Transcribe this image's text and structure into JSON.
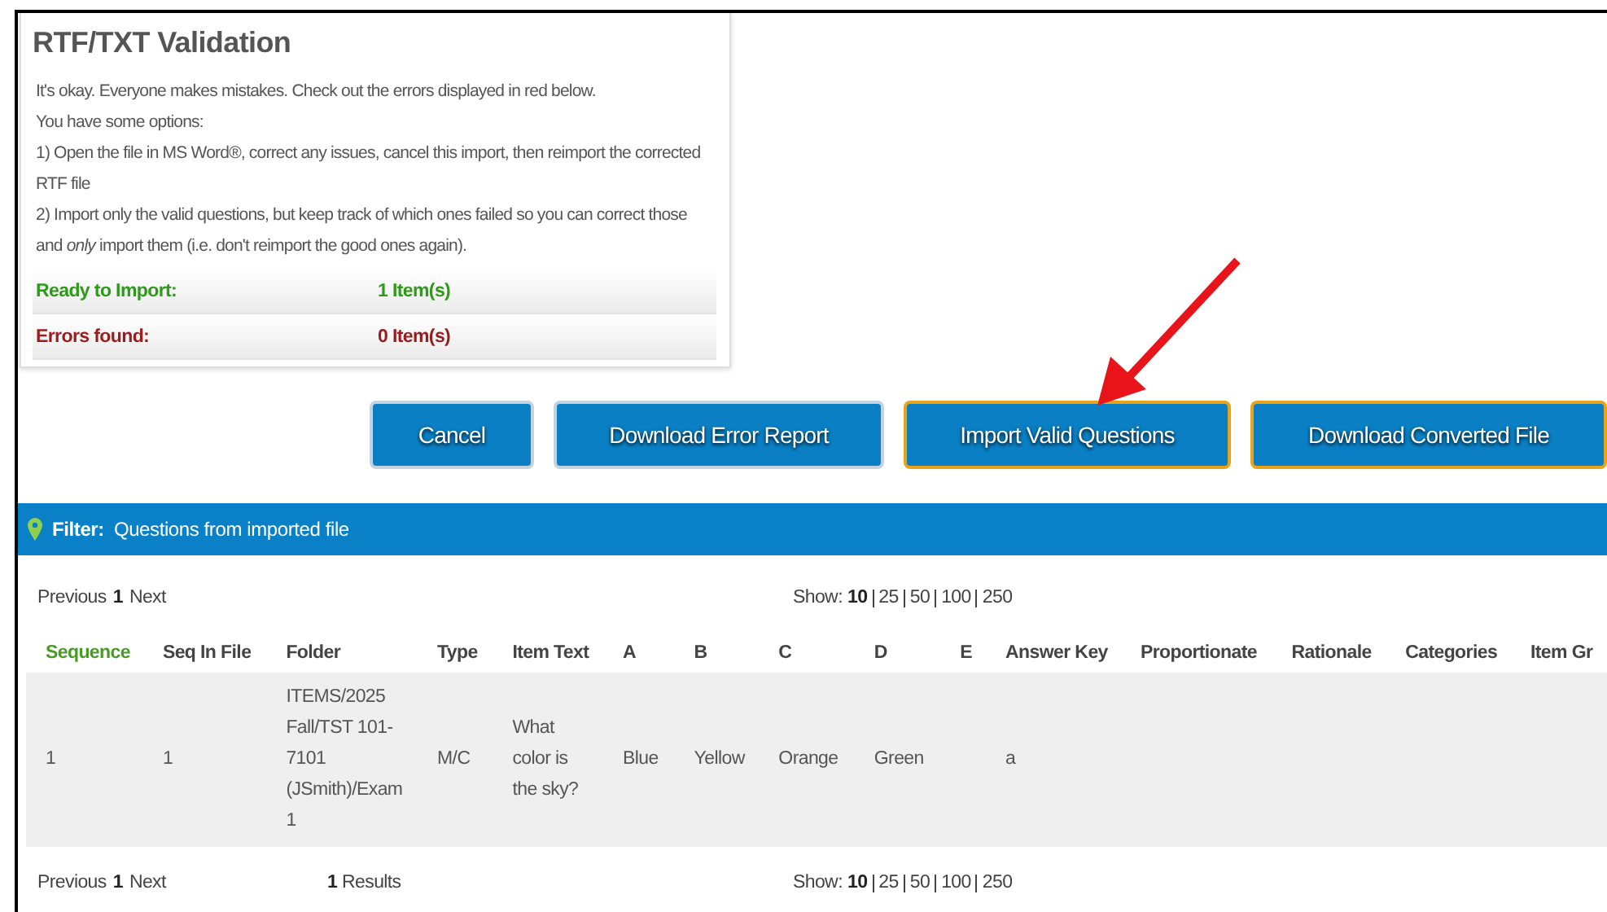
{
  "validation": {
    "title": "RTF/TXT Validation",
    "lines": [
      "It's okay. Everyone makes mistakes. Check out the errors displayed in red below.",
      "You have some options:",
      "1) Open the file in MS Word®, correct any issues, cancel this import, then reimport the corrected RTF file",
      "2) Import only the valid questions, but keep track of which ones failed so you can correct those and *only* import them (i.e. don't reimport the good ones again)."
    ],
    "summary": [
      {
        "kind": "ok",
        "label": "Ready to Import:",
        "value": "1 Item(s)"
      },
      {
        "kind": "error",
        "label": "Errors found:",
        "value": "0 Item(s)"
      }
    ]
  },
  "buttons": [
    {
      "label": "Cancel",
      "highlighted": false
    },
    {
      "label": "Download Error Report",
      "highlighted": false
    },
    {
      "label": "Import Valid Questions",
      "highlighted": true
    },
    {
      "label": "Download Converted File",
      "highlighted": true
    }
  ],
  "filter": {
    "label": "Filter:",
    "value": "Questions from imported file"
  },
  "pager_top": {
    "pages": [
      {
        "label": "Previous",
        "selected": false
      },
      {
        "label": "1",
        "selected": true
      },
      {
        "label": "Next",
        "selected": false
      }
    ],
    "show_label": "Show:",
    "show_options": [
      {
        "label": "10",
        "selected": true
      },
      {
        "label": "25",
        "selected": false
      },
      {
        "label": "50",
        "selected": false
      },
      {
        "label": "100",
        "selected": false
      },
      {
        "label": "250",
        "selected": false
      }
    ]
  },
  "table": {
    "columns": [
      {
        "label": "Sequence",
        "sorted": true
      },
      {
        "label": "Seq In File",
        "sorted": false
      },
      {
        "label": "Folder",
        "sorted": false
      },
      {
        "label": "Type",
        "sorted": false
      },
      {
        "label": "Item Text",
        "sorted": false
      },
      {
        "label": "A",
        "sorted": false
      },
      {
        "label": "B",
        "sorted": false
      },
      {
        "label": "C",
        "sorted": false
      },
      {
        "label": "D",
        "sorted": false
      },
      {
        "label": "E",
        "sorted": false
      },
      {
        "label": "Answer Key",
        "sorted": false
      },
      {
        "label": "Proportionate",
        "sorted": false
      },
      {
        "label": "Rationale",
        "sorted": false
      },
      {
        "label": "Categories",
        "sorted": false
      },
      {
        "label": "Item Gr",
        "sorted": false
      }
    ],
    "rows": [
      [
        "1",
        "1",
        "ITEMS/2025 Fall/TST 101-7101 (JSmith)/Exam 1",
        "M/C",
        "What color is the sky?",
        "Blue",
        "Yellow",
        "Orange",
        "Green",
        "",
        "a",
        "",
        "",
        "",
        ""
      ]
    ]
  },
  "pager_bottom": {
    "pages": [
      {
        "label": "Previous",
        "selected": false
      },
      {
        "label": "1",
        "selected": true
      },
      {
        "label": "Next",
        "selected": false
      }
    ],
    "results_count": "1",
    "results_label": "Results",
    "show_label": "Show:",
    "show_options": [
      {
        "label": "10",
        "selected": true
      },
      {
        "label": "25",
        "selected": false
      },
      {
        "label": "50",
        "selected": false
      },
      {
        "label": "100",
        "selected": false
      },
      {
        "label": "250",
        "selected": false
      }
    ]
  }
}
